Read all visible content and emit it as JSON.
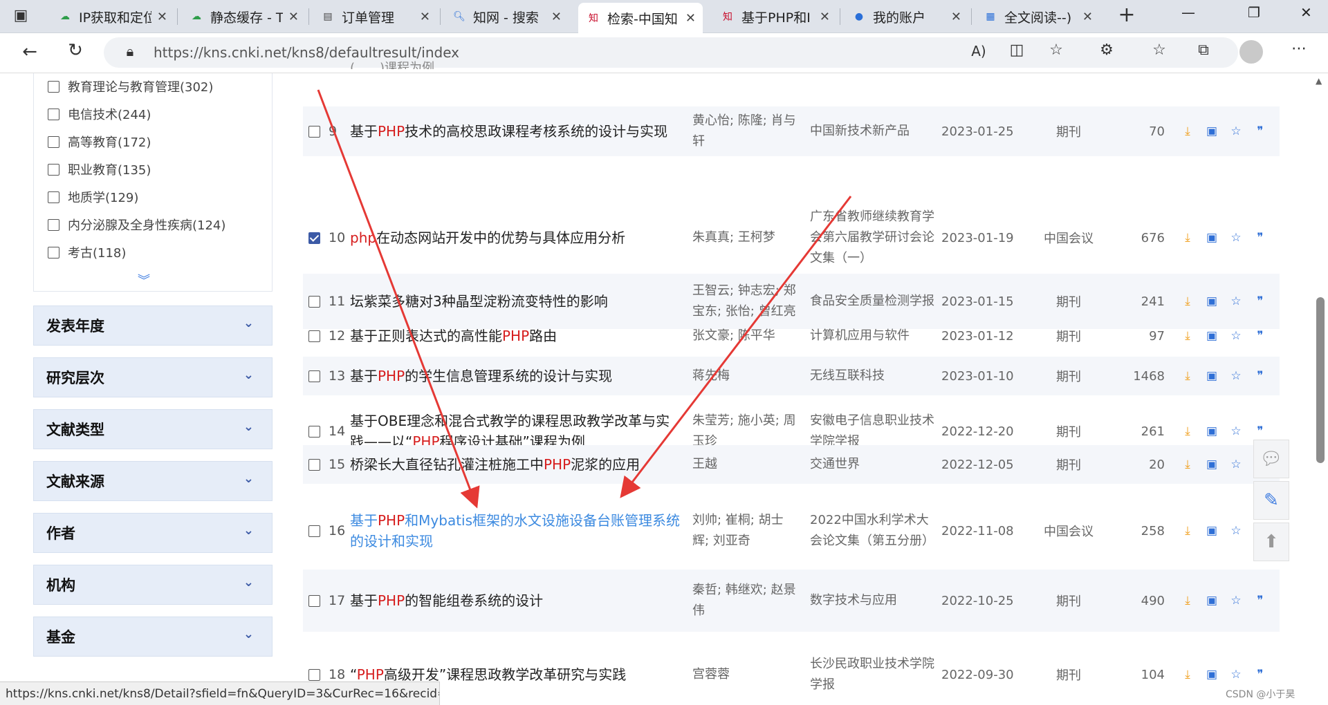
{
  "browser": {
    "tabs": [
      {
        "title": "IP获取和定位",
        "favicon": "cloud-icon"
      },
      {
        "title": "静态缓存 - T",
        "favicon": "cloud-icon"
      },
      {
        "title": "订单管理",
        "favicon": "page-icon"
      },
      {
        "title": "知网 - 搜索",
        "favicon": "search-icon"
      },
      {
        "title": "检索-中国知",
        "favicon": "cnki-icon",
        "active": true
      },
      {
        "title": "基于PHP和I",
        "favicon": "cnki-icon"
      },
      {
        "title": "我的账户",
        "favicon": "account-icon"
      },
      {
        "title": "全文阅读--)",
        "favicon": "doc-icon"
      }
    ],
    "new_tab": "+",
    "url": "https://kns.cnki.net/kns8/defaultresult/index",
    "status_url": "https://kns.cnki.net/kns8/Detail?sfield=fn&QueryID=3&CurRec=16&recid=..."
  },
  "sidebar": {
    "facets": [
      {
        "label": "教育理论与教育管理(302)"
      },
      {
        "label": "电信技术(244)"
      },
      {
        "label": "高等教育(172)"
      },
      {
        "label": "职业教育(135)"
      },
      {
        "label": "地质学(129)"
      },
      {
        "label": "内分泌腺及全身性疾病(124)"
      },
      {
        "label": "考古(118)"
      }
    ],
    "sections": [
      {
        "label": "发表年度"
      },
      {
        "label": "研究层次"
      },
      {
        "label": "文献类型"
      },
      {
        "label": "文献来源"
      },
      {
        "label": "作者"
      },
      {
        "label": "机构"
      },
      {
        "label": "基金"
      }
    ]
  },
  "results": {
    "top_fragment": "(……)课程为例",
    "rows": [
      {
        "num": "9",
        "title_parts": [
          "基于",
          "PHP",
          "技术的高校思政课程考核系统的设计与实现"
        ],
        "authors": "黄心怡; 陈隆; 肖与轩",
        "source": "中国新技术新产品",
        "date": "2023-01-25",
        "type": "期刊",
        "downloads": "70",
        "checked": false
      },
      {
        "num": "10",
        "title_parts": [
          "",
          "php",
          "在动态网站开发中的优势与具体应用分析"
        ],
        "authors": "朱真真; 王柯梦",
        "source": "广东省教师继续教育学会第六届教学研讨会论文集（一）",
        "date": "2023-01-19",
        "type": "中国会议",
        "downloads": "676",
        "checked": true
      },
      {
        "num": "11",
        "title_parts": [
          "坛紫菜多糖对3种晶型淀粉流变特性的影响",
          "",
          ""
        ],
        "authors": "王智云; 钟志宏; 郑宝东; 张怡; 曾红亮",
        "source": "食品安全质量检测学报",
        "date": "2023-01-15",
        "type": "期刊",
        "downloads": "241",
        "checked": false
      },
      {
        "num": "12",
        "title_parts": [
          "基于正则表达式的高性能",
          "PHP",
          "路由"
        ],
        "authors": "张文豪; 陈平华",
        "source": "计算机应用与软件",
        "date": "2023-01-12",
        "type": "期刊",
        "downloads": "97",
        "checked": false
      },
      {
        "num": "13",
        "title_parts": [
          "基于",
          "PHP",
          "的学生信息管理系统的设计与实现"
        ],
        "authors": "蒋先梅",
        "source": "无线互联科技",
        "date": "2023-01-10",
        "type": "期刊",
        "downloads": "1468",
        "checked": false
      },
      {
        "num": "14",
        "title_parts": [
          "基于OBE理念和混合式教学的课程思政教学改革与实践——以“",
          "PHP",
          "程序设计基础”课程为例"
        ],
        "authors": "朱莹芳; 施小英; 周玉珍",
        "source": "安徽电子信息职业技术学院学报",
        "date": "2022-12-20",
        "type": "期刊",
        "downloads": "261",
        "checked": false
      },
      {
        "num": "15",
        "title_parts": [
          "桥梁长大直径钻孔灌注桩施工中",
          "PHP",
          "泥浆的应用"
        ],
        "authors": "王越",
        "source": "交通世界",
        "date": "2022-12-05",
        "type": "期刊",
        "downloads": "20",
        "checked": false
      },
      {
        "num": "16",
        "title_parts": [
          "基于",
          "PHP",
          "和Mybatis框架的水文设施设备台账管理系统的设计和实现"
        ],
        "authors": "刘帅; 崔桐; 胡士辉; 刘亚奇",
        "source": "2022中国水利学术大会论文集（第五分册）",
        "date": "2022-11-08",
        "type": "中国会议",
        "downloads": "258",
        "checked": false,
        "link": true
      },
      {
        "num": "17",
        "title_parts": [
          "基于",
          "PHP",
          "的智能组卷系统的设计"
        ],
        "authors": "秦哲; 韩继欢; 赵景伟",
        "source": "数字技术与应用",
        "date": "2022-10-25",
        "type": "期刊",
        "downloads": "490",
        "checked": false
      },
      {
        "num": "18",
        "title_parts": [
          "“",
          "PHP",
          "高级开发”课程思政教学改革研究与实践"
        ],
        "authors": "宫蓉蓉",
        "source": "长沙民政职业技术学院学报",
        "date": "2022-09-30",
        "type": "期刊",
        "downloads": "104",
        "checked": false
      }
    ]
  },
  "watermark": "CSDN @小于昊",
  "colors": {
    "highlight": "#d61d1d",
    "link": "#3c8ae0",
    "arrow": "#e53935",
    "section_bg": "#e6edf8"
  }
}
